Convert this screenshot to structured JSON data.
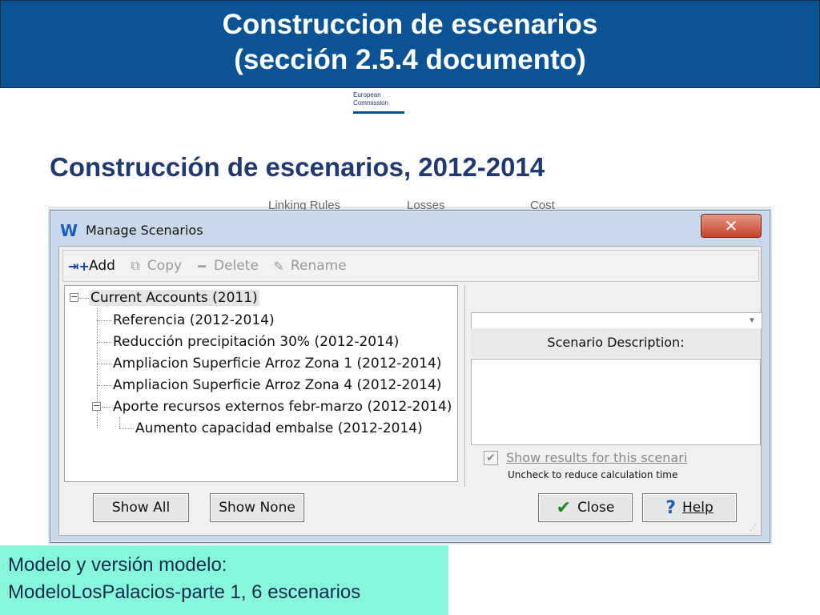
{
  "slide": {
    "title_line1": "Construccion de escenarios",
    "title_line2": "(sección 2.5.4 documento)",
    "logo_line1": "European",
    "logo_line2": "Commission",
    "subtitle": "Construcción de escenarios, 2012-2014"
  },
  "background_window": {
    "fragment1": "Linking Rules",
    "fragment2": "Losses",
    "fragment3": "Cost"
  },
  "dialog": {
    "title": "Manage Scenarios",
    "app_icon_glyph": "W",
    "close_glyph": "✕",
    "toolbar": {
      "add": "Add",
      "copy": "Copy",
      "delete": "Delete",
      "rename": "Rename"
    },
    "tree": {
      "root": "Current Accounts (2011)",
      "items": [
        "Referencia (2012-2014)",
        "Reducción precipitación 30% (2012-2014)",
        "Ampliacion Superficie Arroz Zona 1 (2012-2014)",
        "Ampliacion Superficie Arroz Zona 4 (2012-2014)",
        "Aporte recursos externos febr-marzo (2012-2014)"
      ],
      "child": "Aumento capacidad embalse (2012-2014)"
    },
    "description_label": "Scenario Description:",
    "show_results_label": "Show results for this scenari",
    "show_results_hint": "Uncheck to reduce calculation time",
    "buttons": {
      "show_all": "Show All",
      "show_none": "Show None",
      "close": "Close",
      "help": "Help"
    }
  },
  "info_box": {
    "line1": "Modelo y versión modelo:",
    "line2": "ModeloLosPalacios-parte 1, 6 escenarios"
  },
  "colors": {
    "title_bar": "#0b5394",
    "subtitle": "#1f3a73",
    "info_box": "#86f7dc",
    "dialog_frame": "#c9d9ec",
    "close_button": "#c4402a"
  }
}
